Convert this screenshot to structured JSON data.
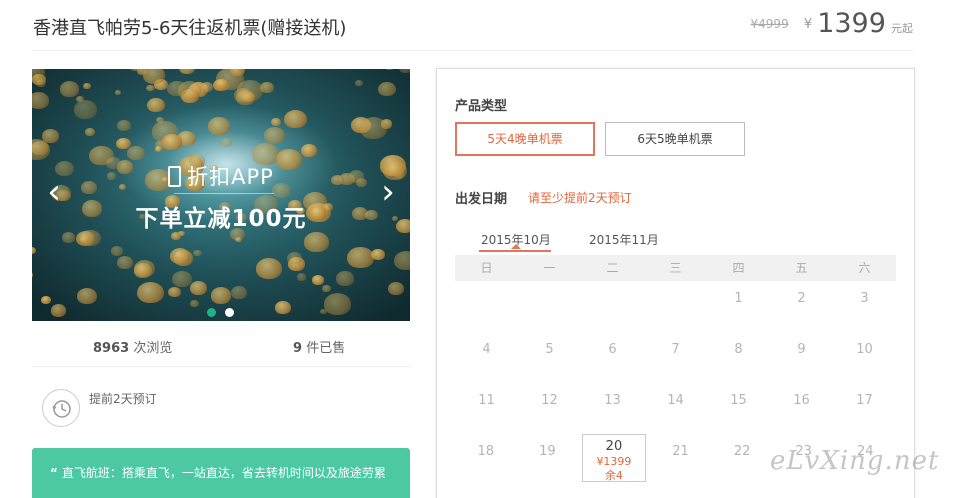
{
  "product": {
    "title": "香港直飞帕劳5-6天往返机票(赠接送机)"
  },
  "price": {
    "original": "¥4999",
    "currency": "¥",
    "current": "1399",
    "suffix": "元起"
  },
  "slider": {
    "promo_line1": "折扣APP",
    "promo_line2": "下单立减100元",
    "prev_arrow": "‹",
    "next_arrow": "›",
    "active_dot": 1,
    "dot_count": 2
  },
  "stats": {
    "views_count": "8963",
    "views_label": "次浏览",
    "sold_count": "9",
    "sold_label": "件已售"
  },
  "advance": {
    "text": "提前2天预订"
  },
  "note": {
    "quote": "“",
    "text": "直飞航班：搭乘直飞，一站直达，省去转机时间以及旅途劳累"
  },
  "booking": {
    "type_label": "产品类型",
    "options": [
      "5天4晚单机票",
      "6天5晚单机票"
    ],
    "selected_option": 0,
    "date_label": "出发日期",
    "date_notice": "请至少提前2天预订",
    "months": [
      "2015年10月",
      "2015年11月"
    ],
    "active_month": 0,
    "weekdays": [
      "日",
      "一",
      "二",
      "三",
      "四",
      "五",
      "六"
    ],
    "calendar_rows": [
      [
        "",
        "",
        "",
        "",
        "1",
        "2",
        "3"
      ],
      [
        "4",
        "5",
        "6",
        "7",
        "8",
        "9",
        "10"
      ],
      [
        "11",
        "12",
        "13",
        "14",
        "15",
        "16",
        "17"
      ],
      [
        "18",
        "19",
        "20",
        "21",
        "22",
        "23",
        "24"
      ]
    ],
    "available_day": {
      "day": "20",
      "price": "¥1399",
      "stock": "余4"
    }
  },
  "watermark": "eLvXing.net",
  "colors": {
    "accent": "#e4653d",
    "green": "#4cc9a3",
    "dot_active": "#1fb388"
  }
}
